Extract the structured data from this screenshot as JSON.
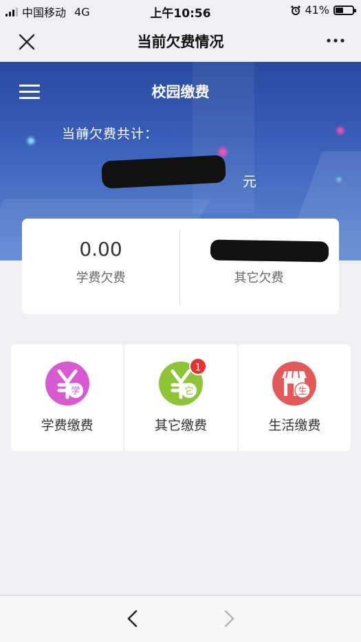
{
  "status_bar": {
    "carrier": "中国移动",
    "network": "4G",
    "time": "上午10:56",
    "battery": "41%"
  },
  "navbar": {
    "title": "当前欠费情况"
  },
  "banner": {
    "title": "校园缴费",
    "debt_label": "当前欠费共计：",
    "unit": "元"
  },
  "summary": {
    "tuition_value": "0.00",
    "tuition_label": "学费欠费",
    "other_label": "其它欠费"
  },
  "services": [
    {
      "label": "学费缴费",
      "icon_text": "学",
      "icon": "tuition-payment-icon",
      "color": "#d65ad0"
    },
    {
      "label": "其它缴费",
      "icon_text": "它",
      "icon": "other-payment-icon",
      "color": "#8fc43a",
      "badge": "1"
    },
    {
      "label": "生活缴费",
      "icon_text": "生",
      "icon": "life-payment-icon",
      "color": "#e05a5a"
    }
  ]
}
